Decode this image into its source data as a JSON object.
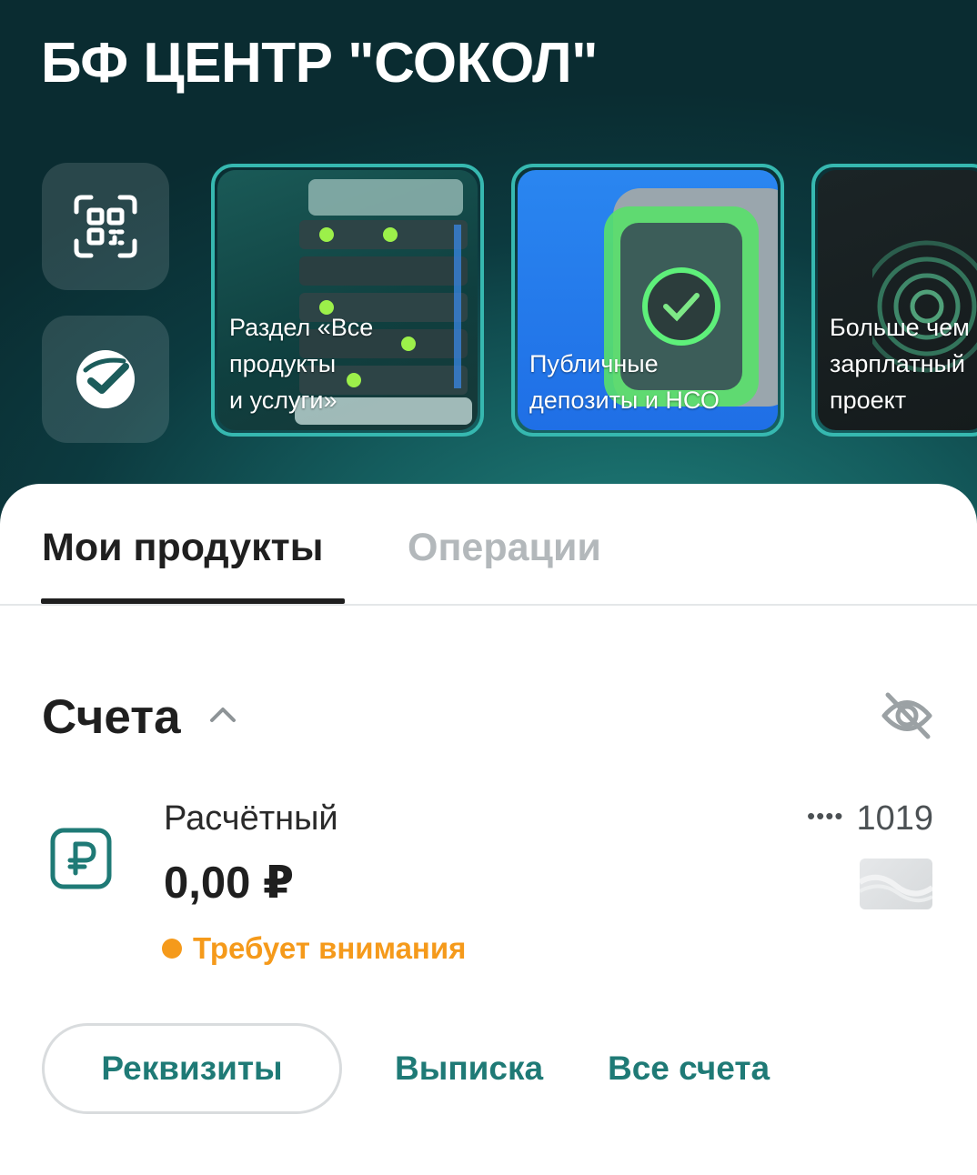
{
  "header": {
    "title": "БФ ЦЕНТР \"СОКОЛ\""
  },
  "quick_actions": [
    {
      "icon": "qr-scan-icon"
    },
    {
      "icon": "sber-logo-icon"
    }
  ],
  "stories": [
    {
      "label": "Раздел «Все\nпродукты\nи услуги»"
    },
    {
      "label": "Публичные\nдепозиты и НСО"
    },
    {
      "label": "Больше чем\nзарплатный\nпроект"
    }
  ],
  "tabs": [
    {
      "label": "Мои продукты",
      "active": true
    },
    {
      "label": "Операции",
      "active": false
    }
  ],
  "accounts_section": {
    "title": "Счета",
    "expand_icon": "chevron-up-icon",
    "visibility_icon": "eye-off-icon"
  },
  "account": {
    "icon": "ruble-icon",
    "name": "Расчётный",
    "balance": "0,00 ₽",
    "masked_prefix": "••••",
    "number_suffix": "1019",
    "status": "Требует внимания",
    "status_color": "#f59a1b"
  },
  "actions": {
    "requisites": "Реквизиты",
    "statement": "Выписка",
    "all_accounts": "Все счета"
  },
  "colors": {
    "accent": "#1f7a76",
    "header_bg": "#0c3a3f",
    "story_border": "#36b8b0"
  }
}
